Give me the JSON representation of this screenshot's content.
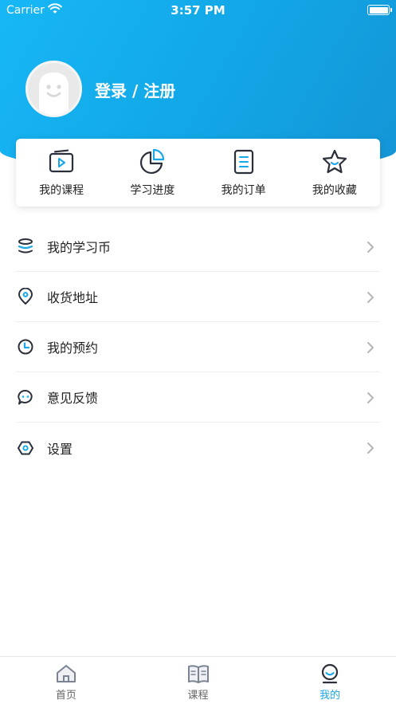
{
  "status_bar": {
    "carrier": "Carrier",
    "time": "3:57 PM"
  },
  "profile": {
    "login_text": "登录 / 注册"
  },
  "quick_actions": [
    {
      "label": "我的课程",
      "icon": "video-course-icon"
    },
    {
      "label": "学习进度",
      "icon": "pie-chart-icon"
    },
    {
      "label": "我的订单",
      "icon": "order-list-icon"
    },
    {
      "label": "我的收藏",
      "icon": "star-icon"
    }
  ],
  "menu": [
    {
      "label": "我的学习币",
      "icon": "coin-stack-icon"
    },
    {
      "label": "收货地址",
      "icon": "location-pin-icon"
    },
    {
      "label": "我的预约",
      "icon": "clock-icon"
    },
    {
      "label": "意见反馈",
      "icon": "chat-bubble-icon"
    },
    {
      "label": "设置",
      "icon": "settings-hexagon-icon"
    }
  ],
  "tabs": [
    {
      "label": "首页",
      "icon": "home-icon",
      "active": false
    },
    {
      "label": "课程",
      "icon": "book-icon",
      "active": false
    },
    {
      "label": "我的",
      "icon": "profile-icon",
      "active": true
    }
  ],
  "colors": {
    "accent": "#1aa7ea",
    "header_start": "#17b7f5",
    "header_end": "#1495d6",
    "icon_dark": "#2b2f3a"
  }
}
